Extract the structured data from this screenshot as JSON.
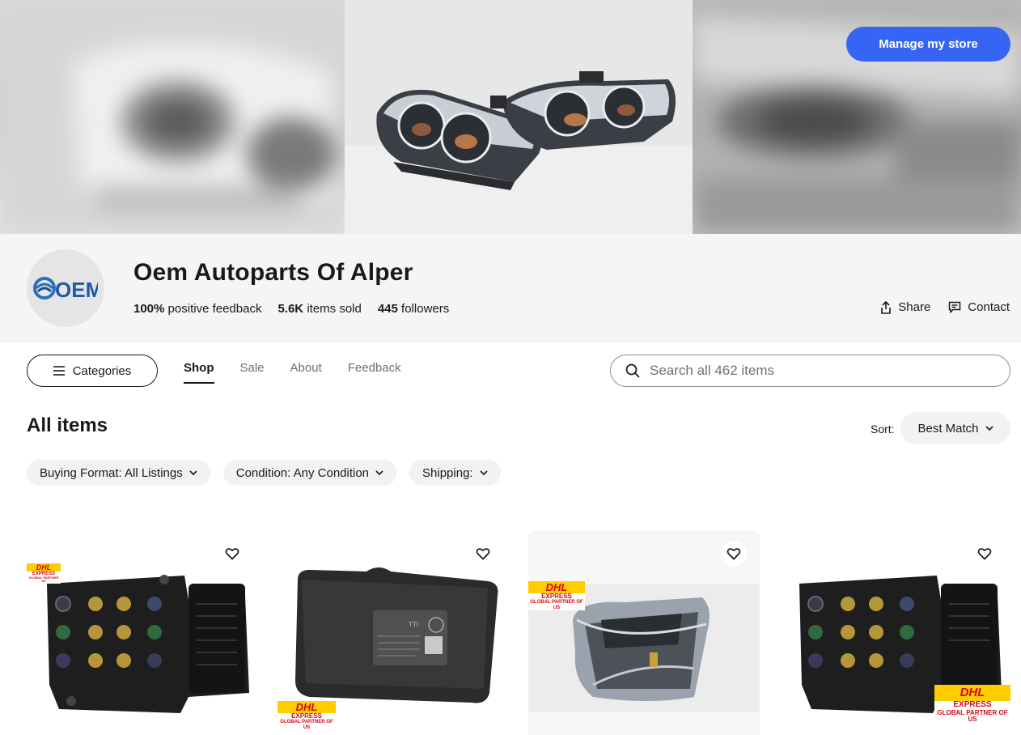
{
  "banner": {
    "manage_button": "Manage my store"
  },
  "store": {
    "logo_text": "OEM",
    "name": "Oem Autoparts Of Alper",
    "feedback": {
      "value": "100%",
      "label": "positive feedback"
    },
    "sold": {
      "value": "5.6K",
      "label": "items sold"
    },
    "followers": {
      "value": "445",
      "label": "followers"
    },
    "share_label": "Share",
    "contact_label": "Contact"
  },
  "nav": {
    "categories_label": "Categories",
    "tabs": [
      {
        "label": "Shop",
        "active": true
      },
      {
        "label": "Sale",
        "active": false
      },
      {
        "label": "About",
        "active": false
      },
      {
        "label": "Feedback",
        "active": false
      }
    ],
    "search_placeholder": "Search all 462 items"
  },
  "items": {
    "title": "All items",
    "sort_label": "Sort:",
    "sort_value": "Best Match",
    "filters": [
      "Buying Format: All Listings",
      "Condition: Any Condition",
      "Shipping:"
    ]
  },
  "products": [
    {
      "image": "abs-pump-module",
      "badge": {
        "brand": "DHL",
        "line1": "EXPRESS",
        "line2": "GLOBAL PARTNER OF",
        "line3": "US"
      }
    },
    {
      "image": "vw-abs-control-unit",
      "label_text": "TTI",
      "badge": {
        "brand": "DHL",
        "line1": "EXPRESS",
        "line2": "GLOBAL PARTNER OF",
        "line3": "US"
      }
    },
    {
      "image": "sealed-bag-part",
      "badge": {
        "brand": "DHL",
        "line1": "EXPRESS",
        "line2": "GLOBAL PARTNER OF",
        "line3": "US"
      }
    },
    {
      "image": "abs-pump-module",
      "badge": {
        "brand": "DHL",
        "line1": "EXPRESS",
        "line2": "GLOBAL PARTNER OF",
        "line3": "US"
      }
    }
  ],
  "colors": {
    "accent": "#3665f3",
    "header_bg": "#f5f5f5",
    "chip_bg": "#f2f2f2",
    "dhl_yellow": "#ffcc00",
    "dhl_red": "#d40511"
  },
  "icons": [
    "heart-icon",
    "share-icon",
    "contact-icon",
    "search-icon",
    "menu-icon",
    "chevron-down-icon"
  ]
}
